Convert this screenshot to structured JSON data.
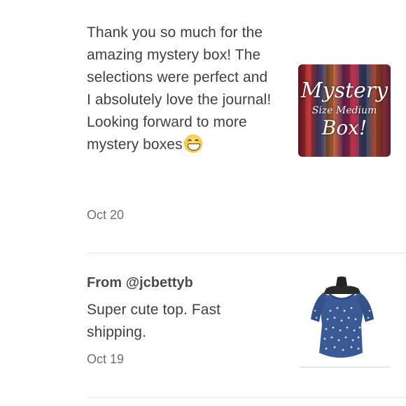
{
  "reviews": [
    {
      "message": "Thank you so much for the amazing mystery box! The selections were perfect and I absolutely love the journal! Looking forward to more mystery boxes",
      "emoji": "grinning-face",
      "date": "Oct 20",
      "image": {
        "lines": [
          "Mystery",
          "Size Medium",
          "Box!"
        ]
      }
    },
    {
      "from_prefix": "From",
      "from_user": "@jcbettyb",
      "message": "Super cute top. Fast shipping.",
      "date": "Oct 19",
      "image": {
        "alt": "blue polka dot top on mannequin"
      }
    }
  ],
  "colors": {
    "text": "#3f3f3f",
    "muted": "#707070",
    "divider": "#e6e6e6",
    "top_blue": "#3a5a95"
  }
}
